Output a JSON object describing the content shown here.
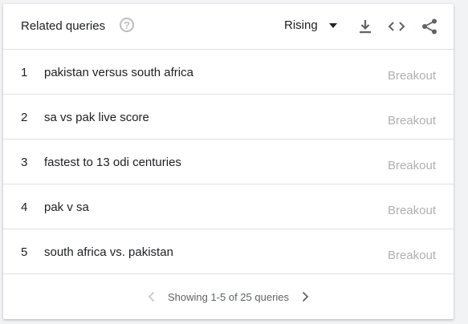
{
  "widget": {
    "title": "Related queries",
    "help_icon": "help-circle-icon",
    "filter_selected": "Rising",
    "actions": [
      "download-icon",
      "embed-code-icon",
      "share-icon"
    ]
  },
  "rows": [
    {
      "rank": "1",
      "query": "pakistan versus south africa",
      "value": "Breakout"
    },
    {
      "rank": "2",
      "query": "sa vs pak live score",
      "value": "Breakout"
    },
    {
      "rank": "3",
      "query": "fastest to 13 odi centuries",
      "value": "Breakout"
    },
    {
      "rank": "4",
      "query": "pak v sa",
      "value": "Breakout"
    },
    {
      "rank": "5",
      "query": "south africa vs. pakistan",
      "value": "Breakout"
    }
  ],
  "pagination": {
    "text": "Showing 1-5 of 25 queries",
    "prev_icon": "chevron-left-icon",
    "next_icon": "chevron-right-icon"
  },
  "colors": {
    "text": "#202124",
    "muted": "#b0b0b0",
    "icon": "#5f6368",
    "divider": "#e0e0e0"
  }
}
